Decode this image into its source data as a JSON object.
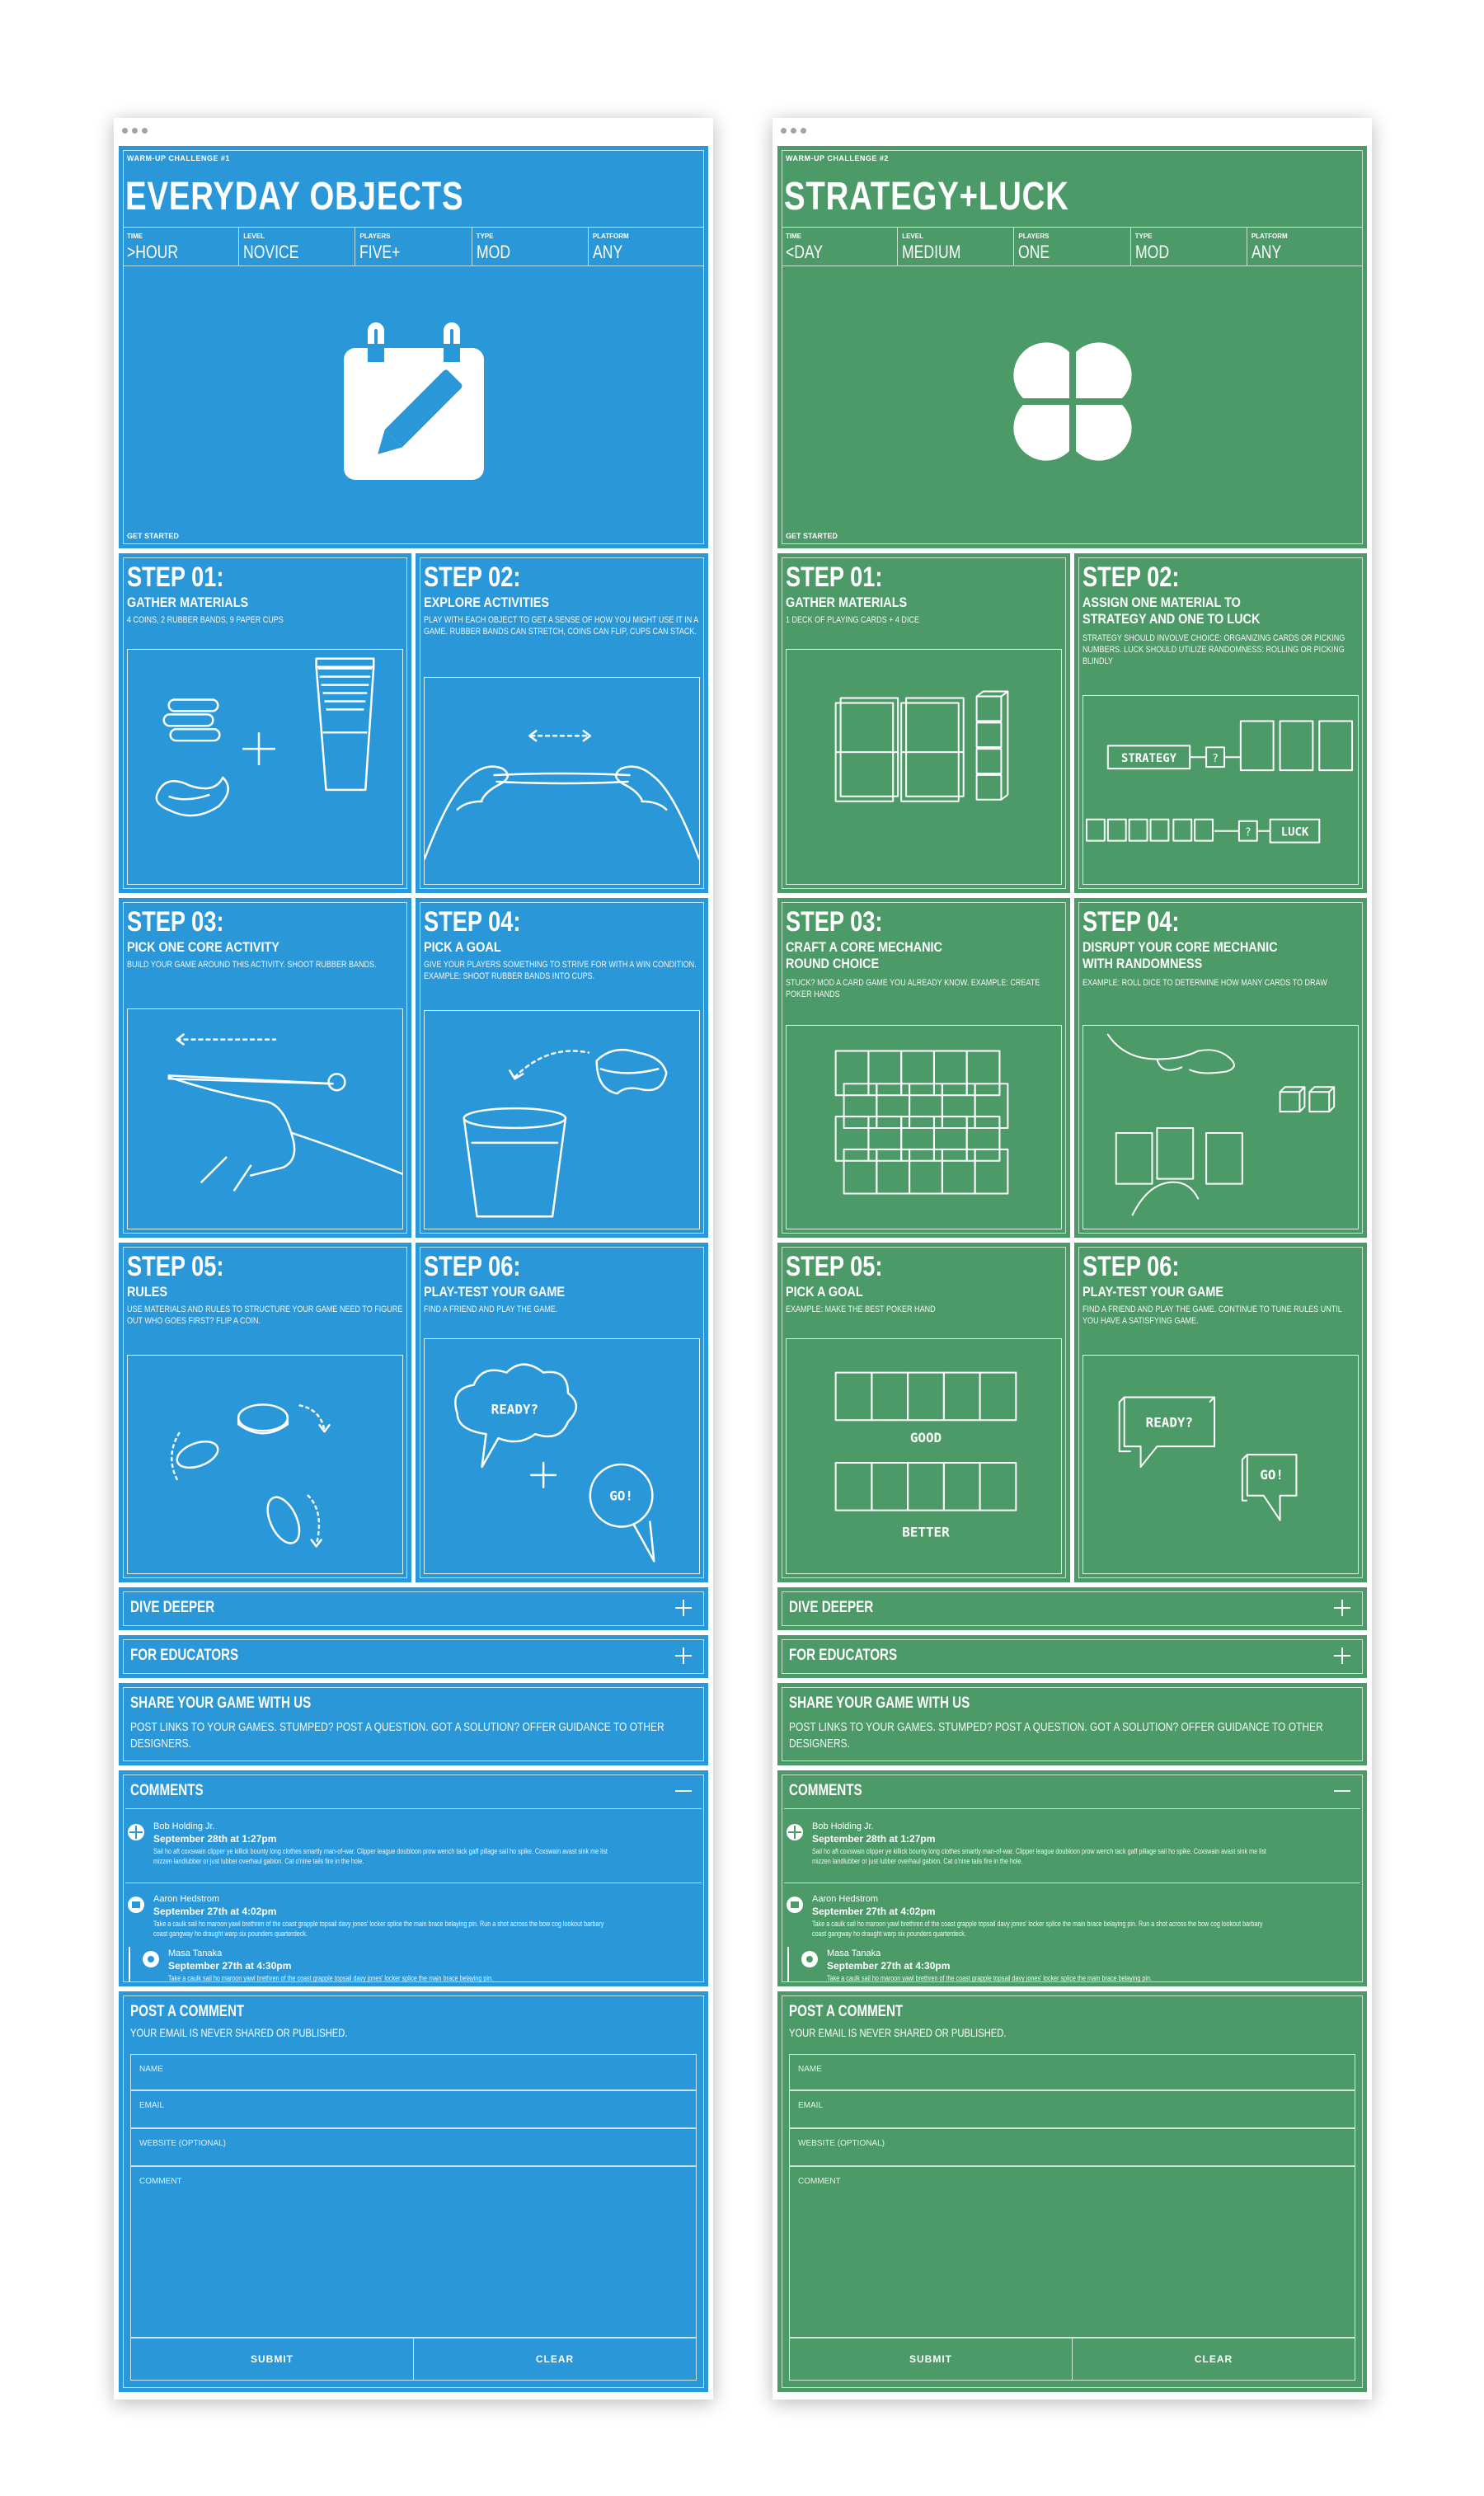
{
  "windows": [
    {
      "challenge_label": "WARM-UP CHALLENGE #1",
      "title": "EVERYDAY OBJECTS",
      "meta": [
        {
          "key": "TIME",
          "value": ">HOUR"
        },
        {
          "key": "LEVEL",
          "value": "NOVICE"
        },
        {
          "key": "PLAYERS",
          "value": "FIVE+"
        },
        {
          "key": "TYPE",
          "value": "MOD"
        },
        {
          "key": "PLATFORM",
          "value": "ANY"
        }
      ],
      "hero_icon": "calendar-pencil-icon",
      "get_started": "GET STARTED",
      "steps": [
        {
          "num": "STEP 01:",
          "title": "GATHER MATERIALS",
          "desc": "4 COINS, 2 RUBBER BANDS, 9 PAPER CUPS"
        },
        {
          "num": "STEP 02:",
          "title": "EXPLORE ACTIVITIES",
          "desc": "PLAY WITH EACH OBJECT TO GET A SENSE OF HOW YOU MIGHT USE IT IN A GAME. RUBBER BANDS CAN STRETCH, COINS CAN FLIP, CUPS CAN STACK."
        },
        {
          "num": "STEP 03:",
          "title": "PICK ONE CORE ACTIVITY",
          "desc": "BUILD YOUR GAME AROUND THIS ACTIVITY. SHOOT RUBBER BANDS."
        },
        {
          "num": "STEP 04:",
          "title": "PICK A GOAL",
          "desc": "GIVE YOUR PLAYERS SOMETHING TO STRIVE FOR WITH A WIN CONDITION. EXAMPLE: SHOOT RUBBER BANDS INTO CUPS."
        },
        {
          "num": "STEP 05:",
          "title": "RULES",
          "desc": "USE MATERIALS AND RULES TO STRUCTURE YOUR GAME NEED TO FIGURE OUT WHO GOES FIRST? FLIP A COIN."
        },
        {
          "num": "STEP 06:",
          "title": "PLAY-TEST YOUR GAME",
          "desc": "FIND A FRIEND AND PLAY THE GAME."
        }
      ],
      "dive_deeper": "DIVE DEEPER",
      "for_educators": "FOR EDUCATORS",
      "share_title": "SHARE YOUR GAME WITH US",
      "share_desc": "POST LINKS TO YOUR GAMES. STUMPED? POST A QUESTION. GOT A SOLUTION? OFFER GUIDANCE TO OTHER DESIGNERS.",
      "comments_title": "COMMENTS",
      "comments": [
        {
          "name": "Bob Holding Jr.",
          "date": "September 28th at 1:27pm",
          "text": "Sail ho aft coxswain clipper ye killick bounty long clothes smartly man-of-war. Clipper league doubloon prow wench tack gaff pillage sail ho spike. Coxswain avast sink me list mizzen landlubber or just lubber overhaul gabion. Cat o'nine tails fire in the hole."
        },
        {
          "name": "Aaron Hedstrom",
          "date": "September 27th at 4:02pm",
          "text": "Take a caulk sail ho maroon yawl brethren of the coast grapple topsail davy jones' locker splice the main brace belaying pin. Run a shot across the bow cog lookout barbary coast gangway ho draught warp six pounders quarterdeck."
        },
        {
          "name": "Masa Tanaka",
          "date": "September 27th at 4:30pm",
          "text": "Take a caulk sail ho maroon yawl brethren of the coast grapple topsail davy jones' locker splice the main brace belaying pin."
        }
      ],
      "post_title": "POST A COMMENT",
      "post_desc": "YOUR EMAIL IS NEVER SHARED OR PUBLISHED.",
      "fields": {
        "name": "NAME",
        "email": "EMAIL",
        "website": "WEBSITE (OPTIONAL)",
        "comment": "COMMENT"
      },
      "submit": "SUBMIT",
      "clear": "CLEAR"
    },
    {
      "challenge_label": "WARM-UP CHALLENGE #2",
      "title": "STRATEGY+LUCK",
      "meta": [
        {
          "key": "TIME",
          "value": "<DAY"
        },
        {
          "key": "LEVEL",
          "value": "MEDIUM"
        },
        {
          "key": "PLAYERS",
          "value": "ONE"
        },
        {
          "key": "TYPE",
          "value": "MOD"
        },
        {
          "key": "PLATFORM",
          "value": "ANY"
        }
      ],
      "hero_icon": "clover-icon",
      "get_started": "GET STARTED",
      "steps": [
        {
          "num": "STEP 01:",
          "title": "GATHER MATERIALS",
          "desc": "1 DECK OF PLAYING CARDS + 4 DICE"
        },
        {
          "num": "STEP 02:",
          "title": "ASSIGN ONE MATERIAL TO\nSTRATEGY AND ONE TO LUCK",
          "desc": "STRATEGY SHOULD INVOLVE CHOICE: ORGANIZING CARDS OR PICKING NUMBERS. LUCK SHOULD UTILIZE RANDOMNESS: ROLLING OR PICKING BLINDLY"
        },
        {
          "num": "STEP 03:",
          "title": "CRAFT A CORE MECHANIC\nROUND CHOICE",
          "desc": "STUCK? MOD A CARD GAME YOU ALREADY KNOW. EXAMPLE: CREATE POKER HANDS"
        },
        {
          "num": "STEP 04:",
          "title": "DISRUPT YOUR CORE MECHANIC\nWITH RANDOMNESS",
          "desc": "EXAMPLE: ROLL DICE TO DETERMINE HOW MANY CARDS TO DRAW"
        },
        {
          "num": "STEP 05:",
          "title": "PICK A GOAL",
          "desc": "EXAMPLE: MAKE THE BEST POKER HAND"
        },
        {
          "num": "STEP 06:",
          "title": "PLAY-TEST YOUR GAME",
          "desc": "FIND A FRIEND AND PLAY THE GAME. CONTINUE TO TUNE RULES UNTIL YOU HAVE A SATISFYING GAME."
        }
      ],
      "illus_labels": {
        "strategy": "STRATEGY",
        "luck": "LUCK",
        "q": "?",
        "good": "GOOD",
        "better": "BETTER",
        "ready": "READY?",
        "go": "GO!"
      },
      "dive_deeper": "DIVE DEEPER",
      "for_educators": "FOR EDUCATORS",
      "share_title": "SHARE YOUR GAME WITH US",
      "share_desc": "POST LINKS TO YOUR GAMES. STUMPED? POST A QUESTION. GOT A SOLUTION? OFFER GUIDANCE TO OTHER DESIGNERS.",
      "comments_title": "COMMENTS",
      "comments": [
        {
          "name": "Bob Holding Jr.",
          "date": "September 28th at 1:27pm",
          "text": "Sail ho aft coxswain clipper ye killick bounty long clothes smartly man-of-war. Clipper league doubloon prow wench tack gaff pillage sail ho spike. Coxswain avast sink me list mizzen landlubber or just lubber overhaul gabion. Cat o'nine tails fire in the hole."
        },
        {
          "name": "Aaron Hedstrom",
          "date": "September 27th at 4:02pm",
          "text": "Take a caulk sail ho maroon yawl brethren of the coast grapple topsail davy jones' locker splice the main brace belaying pin. Run a shot across the bow cog lookout barbary coast gangway ho draught warp six pounders quarterdeck."
        },
        {
          "name": "Masa Tanaka",
          "date": "September 27th at 4:30pm",
          "text": "Take a caulk sail ho maroon yawl brethren of the coast grapple topsail davy jones' locker splice the main brace belaying pin."
        }
      ],
      "post_title": "POST A COMMENT",
      "post_desc": "YOUR EMAIL IS NEVER SHARED OR PUBLISHED.",
      "fields": {
        "name": "NAME",
        "email": "EMAIL",
        "website": "WEBSITE (OPTIONAL)",
        "comment": "COMMENT"
      },
      "submit": "SUBMIT",
      "clear": "CLEAR"
    }
  ],
  "illus_text": {
    "ready": "READY?",
    "go": "GO!"
  },
  "colors": {
    "blue_panel": "#2a97d8",
    "green_panel": "#4c9a67",
    "line": "#ffffff"
  }
}
